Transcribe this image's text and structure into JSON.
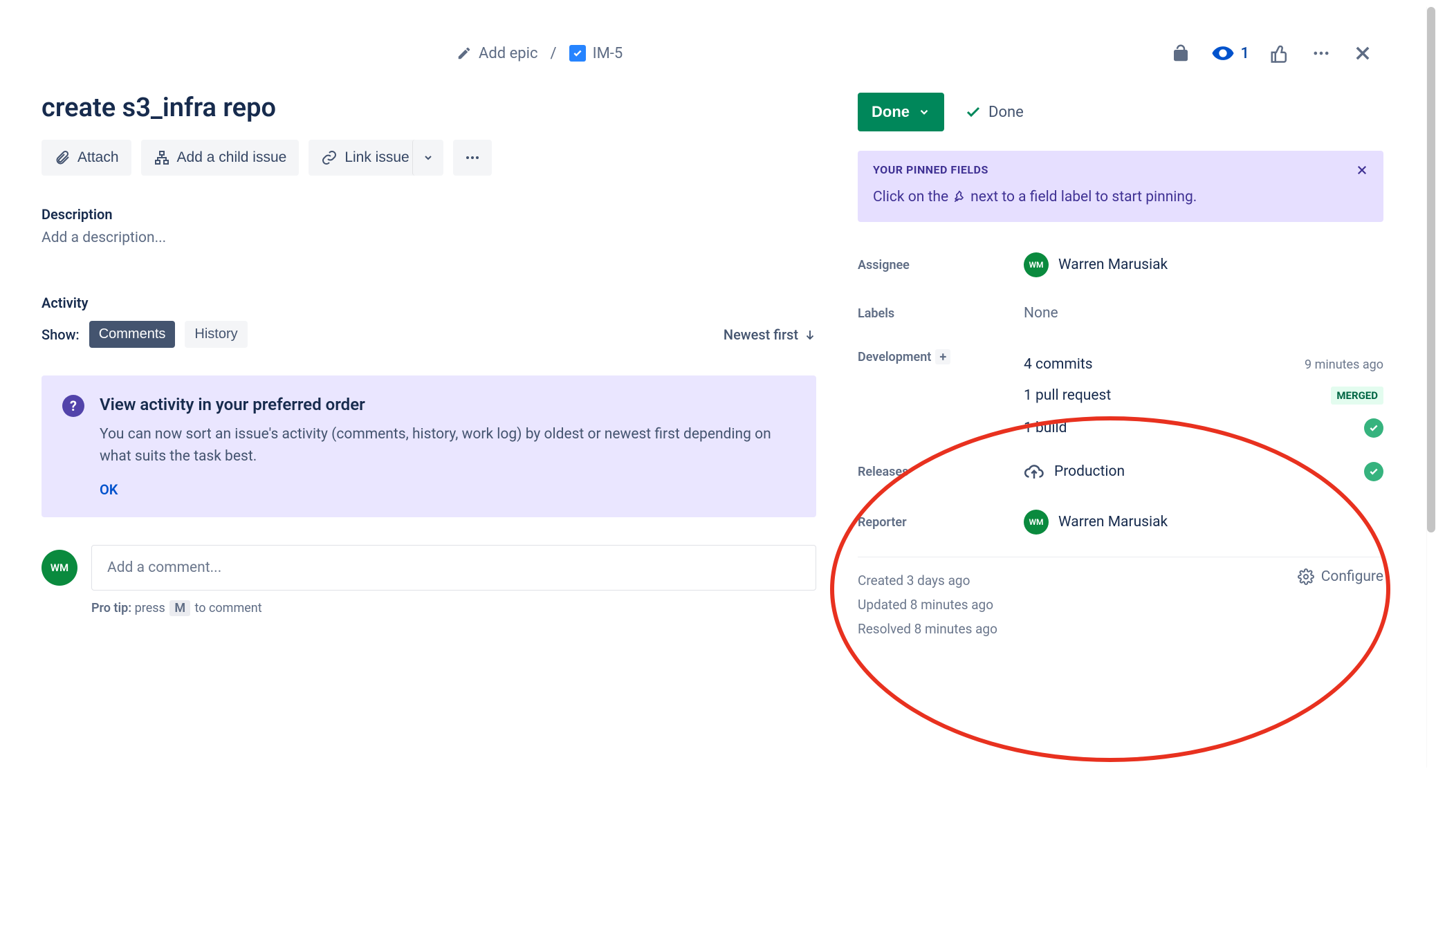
{
  "breadcrumb": {
    "add_epic": "Add epic",
    "issue_key": "IM-5"
  },
  "top_actions": {
    "watch_count": "1"
  },
  "issue": {
    "title": "create s3_infra repo"
  },
  "action_buttons": {
    "attach": "Attach",
    "add_child": "Add a child issue",
    "link_issue": "Link issue"
  },
  "description": {
    "label": "Description",
    "placeholder": "Add a description..."
  },
  "activity": {
    "header": "Activity",
    "show_label": "Show:",
    "tabs": {
      "comments": "Comments",
      "history": "History"
    },
    "sort_label": "Newest first",
    "info": {
      "title": "View activity in your preferred order",
      "body": "You can now sort an issue's activity (comments, history, work log) by oldest or newest first depending on what suits the task best.",
      "ok": "OK"
    },
    "comment_placeholder": "Add a comment...",
    "pro_tip_prefix": "Pro tip:",
    "pro_tip_press": "press",
    "pro_tip_key": "M",
    "pro_tip_suffix": "to comment"
  },
  "avatar_initials": "WM",
  "status": {
    "button_label": "Done",
    "resolution": "Done"
  },
  "pinned": {
    "title": "YOUR PINNED FIELDS",
    "hint_prefix": "Click on the",
    "hint_suffix": "next to a field label to start pinning."
  },
  "fields": {
    "assignee": {
      "label": "Assignee",
      "value": "Warren Marusiak"
    },
    "labels": {
      "label": "Labels",
      "value": "None"
    },
    "development": {
      "label": "Development",
      "commits": "4 commits",
      "commits_time": "9 minutes ago",
      "pr": "1 pull request",
      "pr_status": "MERGED",
      "build": "1 build"
    },
    "releases": {
      "label": "Releases",
      "value": "Production"
    },
    "reporter": {
      "label": "Reporter",
      "value": "Warren Marusiak"
    }
  },
  "meta": {
    "created": "Created 3 days ago",
    "updated": "Updated 8 minutes ago",
    "resolved": "Resolved 8 minutes ago",
    "configure": "Configure"
  }
}
